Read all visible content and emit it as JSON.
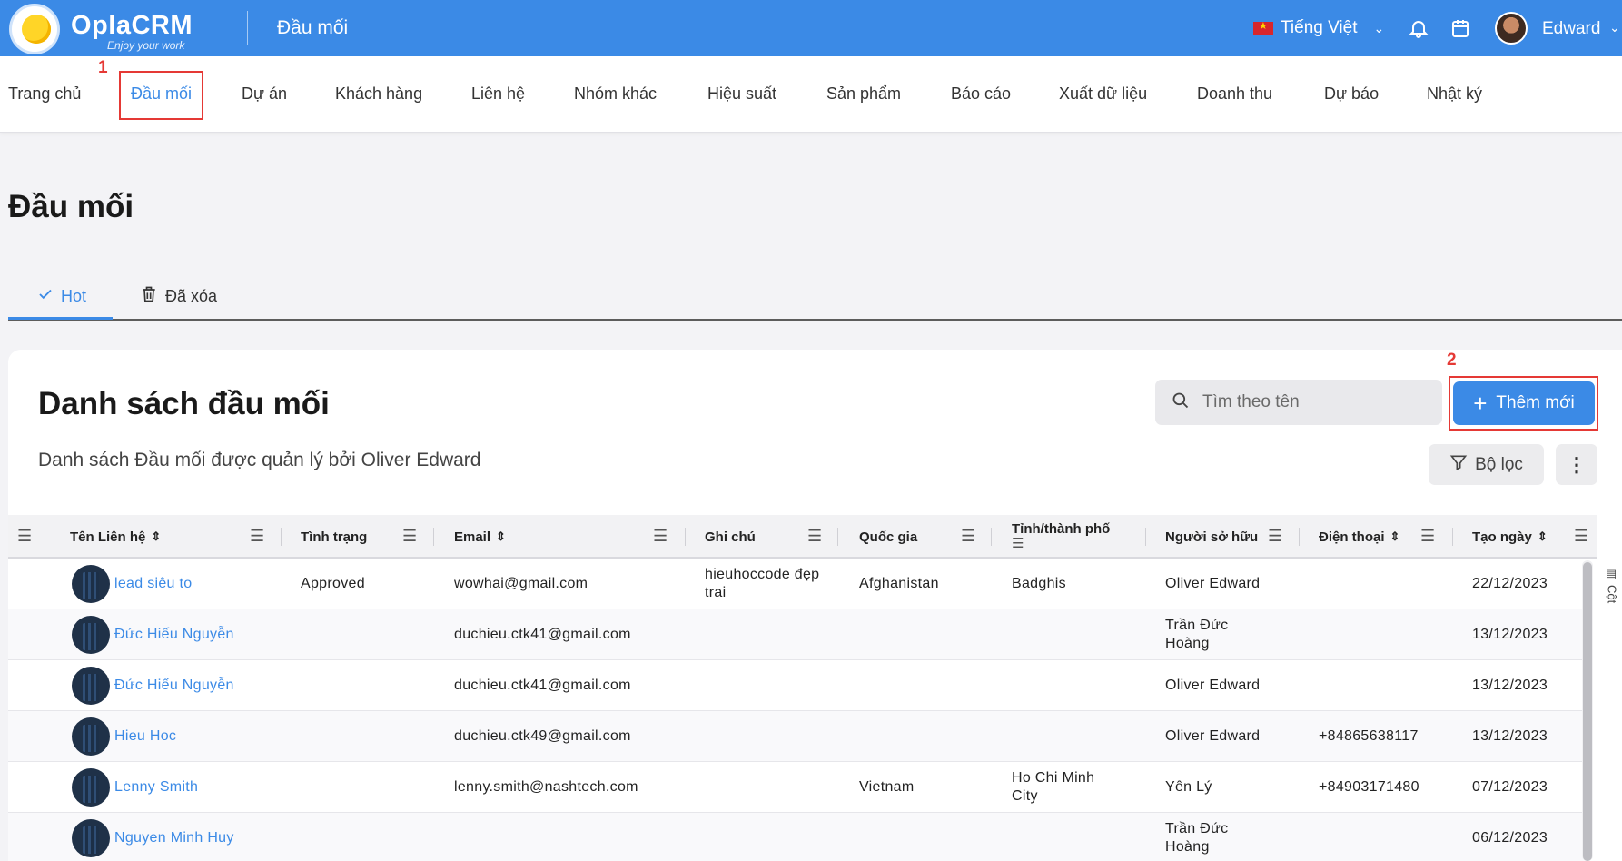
{
  "app": {
    "logo_name": "OplaCRM",
    "logo_tagline": "Enjoy your work",
    "section_title": "Đầu mối",
    "language": "Tiếng Việt",
    "user_name": "Edward"
  },
  "nav": {
    "items": [
      "Trang chủ",
      "Đầu mối",
      "Dự án",
      "Khách hàng",
      "Liên hệ",
      "Nhóm khác",
      "Hiệu suất",
      "Sản phẩm",
      "Báo cáo",
      "Xuất dữ liệu",
      "Doanh thu",
      "Dự báo",
      "Nhật ký"
    ],
    "active": "Đầu mối"
  },
  "annotations": {
    "mark1": "1",
    "mark2": "2",
    "mark_color": "#e53935"
  },
  "page": {
    "title": "Đầu mối"
  },
  "tabs": [
    {
      "label": "Hot",
      "icon": "check-icon",
      "active": true
    },
    {
      "label": "Đã xóa",
      "icon": "trash-icon",
      "active": false
    }
  ],
  "card": {
    "title": "Danh sách đầu mối",
    "subtitle": "Danh sách Đầu mối được quản lý bởi Oliver Edward",
    "search_placeholder": "Tìm theo tên",
    "add_button": "Thêm mới",
    "filter_button": "Bộ lọc",
    "columns_label": "Cột"
  },
  "table": {
    "columns": [
      "Tên Liên hệ",
      "Tình trạng",
      "Email",
      "Ghi chú",
      "Quốc gia",
      "Tỉnh/thành phố",
      "Người sở hữu",
      "Điện thoại",
      "Tạo ngày"
    ],
    "rows": [
      {
        "name": "lead siêu to",
        "status": "Approved",
        "email": "wowhai@gmail.com",
        "note": "hieuhoccode đẹp trai",
        "country": "Afghanistan",
        "province": "Badghis",
        "owner": "Oliver Edward",
        "phone": "",
        "created": "22/12/2023"
      },
      {
        "name": "Đức Hiếu Nguyễn",
        "status": "",
        "email": "duchieu.ctk41@gmail.com",
        "note": "",
        "country": "",
        "province": "",
        "owner": "Trần Đức Hoàng",
        "phone": "",
        "created": "13/12/2023"
      },
      {
        "name": "Đức Hiếu Nguyễn",
        "status": "",
        "email": "duchieu.ctk41@gmail.com",
        "note": "",
        "country": "",
        "province": "",
        "owner": "Oliver Edward",
        "phone": "",
        "created": "13/12/2023"
      },
      {
        "name": "Hieu Hoc",
        "status": "",
        "email": "duchieu.ctk49@gmail.com",
        "note": "",
        "country": "",
        "province": "",
        "owner": "Oliver Edward",
        "phone": "+84865638117",
        "created": "13/12/2023"
      },
      {
        "name": "Lenny Smith",
        "status": "",
        "email": "lenny.smith@nashtech.com",
        "note": "",
        "country": "Vietnam",
        "province": "Ho Chi Minh City",
        "owner": "Yên Lý",
        "phone": "+84903171480",
        "created": "07/12/2023"
      },
      {
        "name": "Nguyen Minh Huy",
        "status": "",
        "email": "",
        "note": "",
        "country": "",
        "province": "",
        "owner": "Trần Đức Hoàng",
        "phone": "",
        "created": "06/12/2023"
      }
    ]
  },
  "colors": {
    "brand": "#3b8ae6",
    "annotation": "#e53935"
  }
}
